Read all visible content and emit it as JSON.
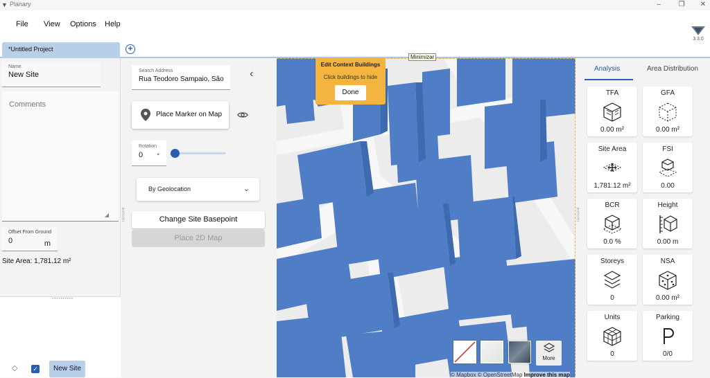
{
  "app": {
    "title": "Planary",
    "version": "3.3.0"
  },
  "window_controls": {
    "minimize": "–",
    "restore": "❐",
    "close": "✕"
  },
  "menu": [
    "File",
    "View",
    "Options",
    "Help"
  ],
  "tabs": {
    "project": "*Untitled Project",
    "add": "+"
  },
  "left": {
    "name_label": "Name",
    "name_value": "New Site",
    "comments_placeholder": "Comments",
    "offset_label": "Offset From Ground",
    "offset_value": "0",
    "offset_unit": "m",
    "site_area": "Site Area: 1,781.12 m²",
    "site_chip": "New Site",
    "checkbox_mark": "✓",
    "layer_symbol": "◇",
    "grip": "••••••••••",
    "resize": "◢"
  },
  "middle": {
    "search_label": "Search Address",
    "search_value": "Rua Teodoro Sampaio, São",
    "back": "‹",
    "place_marker": "Place Marker on Map",
    "rotation_label": "Rotation",
    "rotation_value": "0",
    "rotation_unit": "°",
    "rotation_level": 0,
    "geo_select": "By Geolocation",
    "geo_chevron": "⌄",
    "change_basepoint": "Change Site Basepoint",
    "place_2d_map": "Place 2D Map"
  },
  "map": {
    "tooltip": "Minimizar",
    "popup_title": "Edit Context Buildings",
    "popup_sub": "Click buildings to hide",
    "popup_done": "Done",
    "more": "More",
    "attribution_a": "© Mapbox © OpenStreetMap",
    "attribution_b": "Improve this map",
    "building_color": "#4f7ec6",
    "accent_color": "#f3b440"
  },
  "analysis": {
    "tabs": [
      "Analysis",
      "Area Distribution"
    ],
    "cards": [
      {
        "label": "TFA",
        "value": "0.00 m²",
        "icon": "cube-solid-icon"
      },
      {
        "label": "GFA",
        "value": "0.00 m²",
        "icon": "cube-dashed-icon"
      },
      {
        "label": "Site Area",
        "value": "1,781.12 m²",
        "icon": "site-area-icon"
      },
      {
        "label": "FSI",
        "value": "0.00",
        "icon": "fsi-icon"
      },
      {
        "label": "BCR",
        "value": "0.0 %",
        "icon": "bcr-icon"
      },
      {
        "label": "Height",
        "value": "0.00 m",
        "icon": "height-icon"
      },
      {
        "label": "Storeys",
        "value": "0",
        "icon": "storeys-icon"
      },
      {
        "label": "NSA",
        "value": "0.00 m²",
        "icon": "nsa-icon"
      },
      {
        "label": "Units",
        "value": "0",
        "icon": "units-icon"
      },
      {
        "label": "Parking",
        "value": "0/0",
        "icon": "parking-icon"
      }
    ]
  }
}
